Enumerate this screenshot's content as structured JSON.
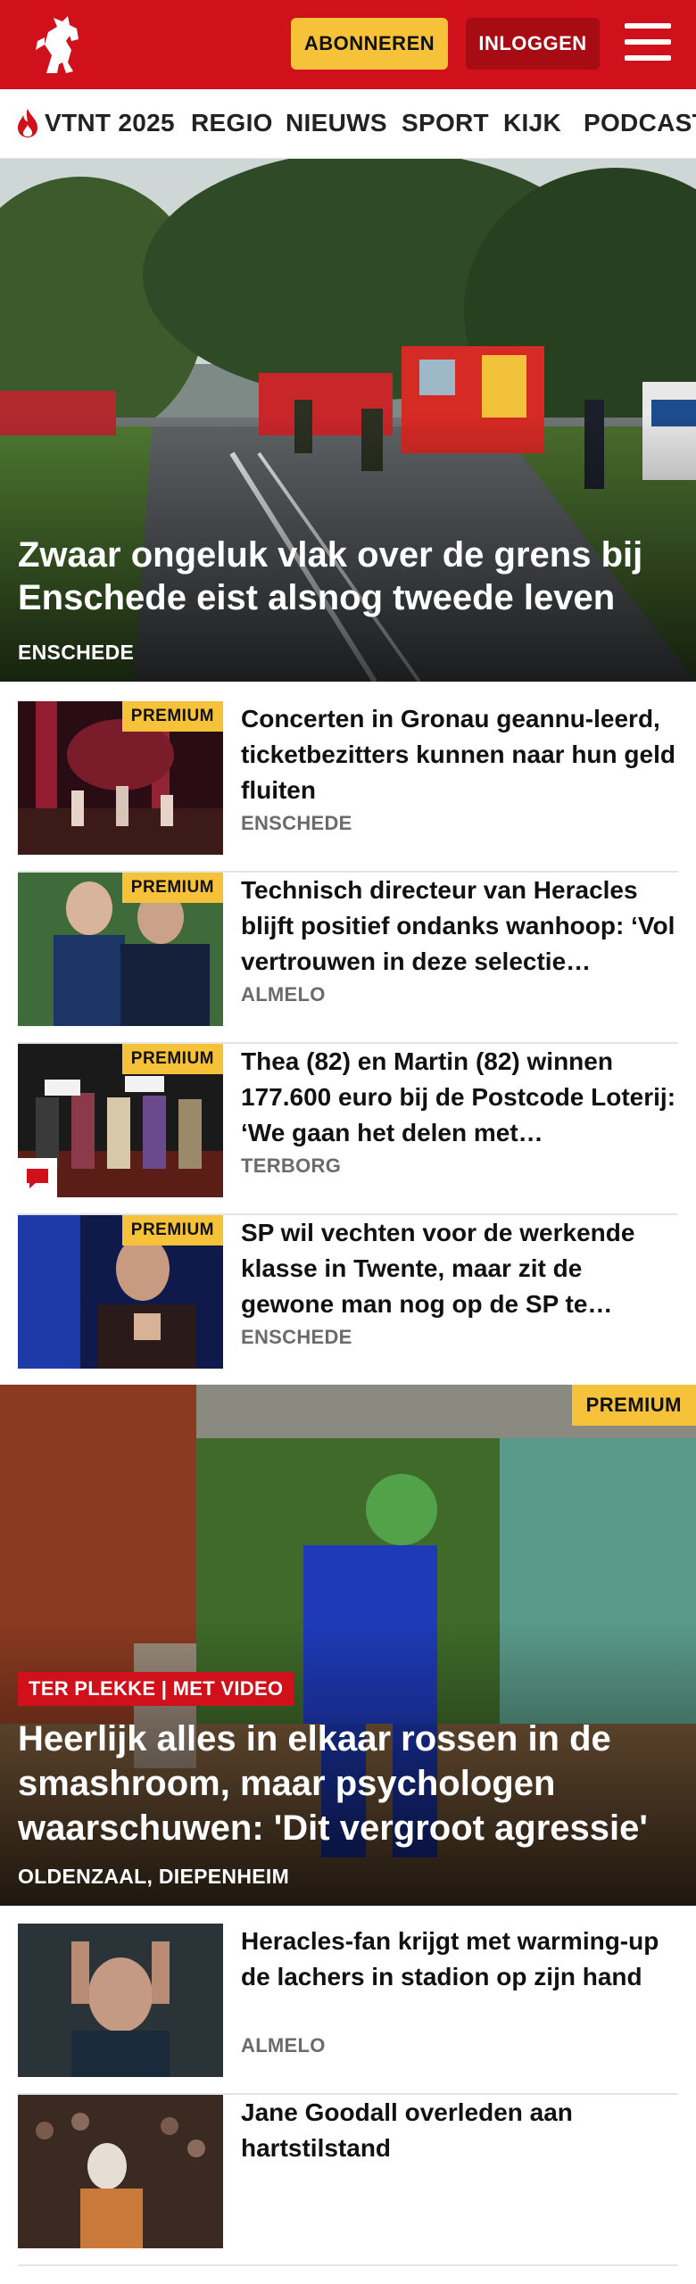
{
  "header": {
    "logo_icon": "twente-horse-logo-icon",
    "subscribe_label": "ABONNEREN",
    "login_label": "INLOGGEN",
    "menu_icon": "hamburger-menu-icon",
    "colors": {
      "brand_red": "#d0111b",
      "accent_yellow": "#f5c23a",
      "login_dark_red": "#a70c14"
    }
  },
  "nav": {
    "items": [
      {
        "label": "VTNT 2025",
        "icon": "flame-icon"
      },
      {
        "label": "REGIO"
      },
      {
        "label": "NIEUWS"
      },
      {
        "label": "SPORT"
      },
      {
        "label": "KIJK"
      },
      {
        "label": "PODCAST"
      }
    ]
  },
  "hero": {
    "title": "Zwaar ongeluk vlak over de grens bij Enschede eist alsnog tweede leven",
    "location": "ENSCHEDE"
  },
  "articles": [
    {
      "premium": "PREMIUM",
      "title": "Concerten in Gronau geannu-leerd, ticketbezitters kunnen naar hun geld fluiten",
      "location": "ENSCHEDE"
    },
    {
      "premium": "PREMIUM",
      "title": "Technisch directeur van Heracles blijft positief ondanks wanhoop: ‘Vol vertrouwen in deze selectie…",
      "location": "ALMELO"
    },
    {
      "premium": "PREMIUM",
      "title": "Thea (82) en Martin (82) winnen 177.600 euro bij de Postcode Loterij: ‘We gaan het delen met…",
      "location": "TERBORG",
      "comment_icon": "comment-bubble-icon"
    },
    {
      "premium": "PREMIUM",
      "title": "SP wil vechten voor de werkende klasse in Twente, maar zit de gewone man nog op de SP te…",
      "location": "ENSCHEDE"
    }
  ],
  "feature": {
    "premium": "PREMIUM",
    "tag": "TER PLEKKE | MET VIDEO",
    "title": "Heerlijk alles in elkaar rossen in de smashroom, maar psychologen waarschuwen: 'Dit vergroot agressie'",
    "location": "OLDENZAAL, DIEPENHEIM"
  },
  "articles2": [
    {
      "title": "Heracles-fan krijgt met warming-up de lachers in stadion op zijn hand",
      "location": "ALMELO"
    },
    {
      "title": "Jane Goodall overleden aan hartstilstand",
      "location": ""
    }
  ]
}
